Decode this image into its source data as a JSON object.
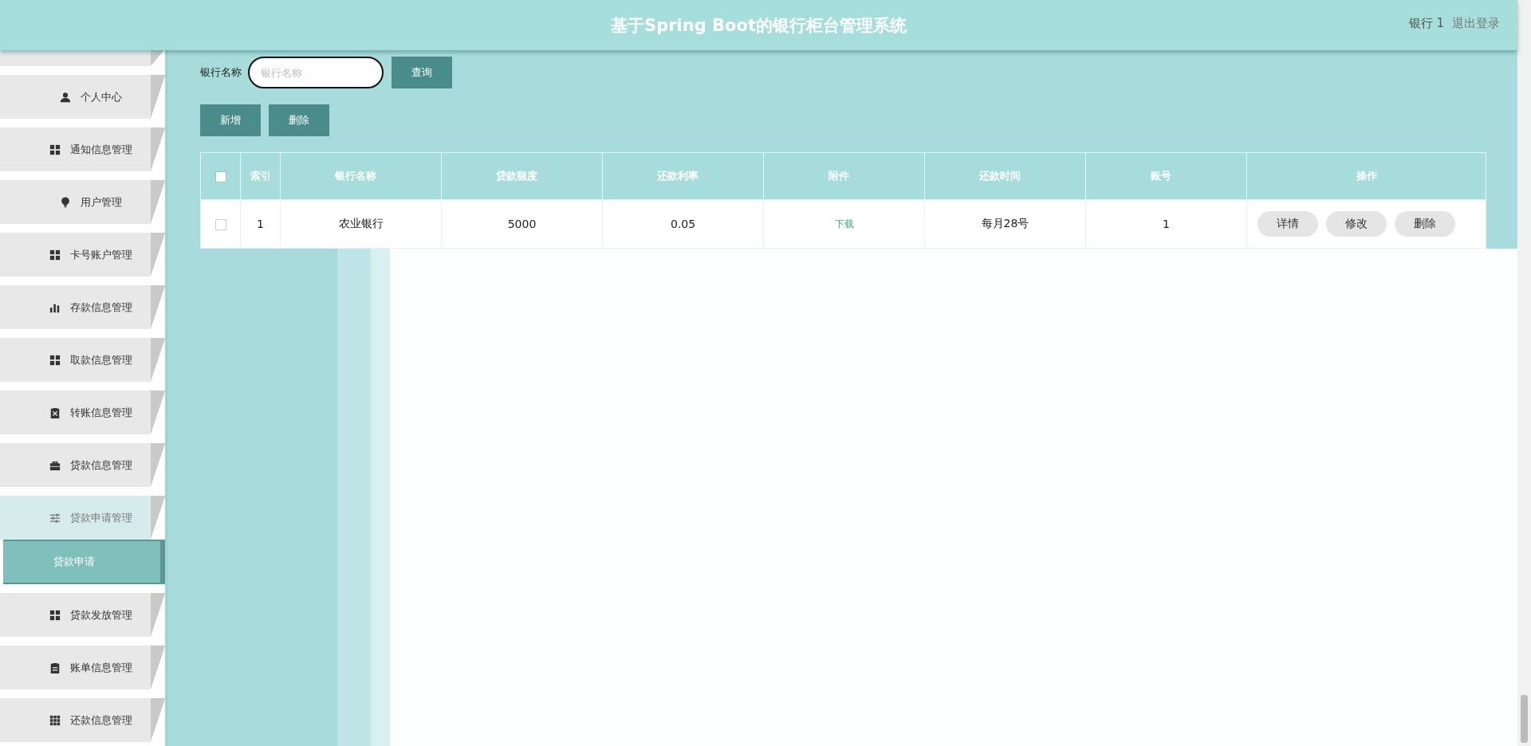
{
  "header": {
    "title": "基于Spring Boot的银行柜台管理系统",
    "user": "银行 1",
    "logout": "退出登录"
  },
  "sidebar": {
    "items": [
      {
        "label": "个人中心",
        "expanded": false
      },
      {
        "label": "通知信息管理",
        "expanded": false
      },
      {
        "label": "用户管理",
        "expanded": false
      },
      {
        "label": "卡号账户管理",
        "expanded": false
      },
      {
        "label": "存款信息管理",
        "expanded": false
      },
      {
        "label": "取款信息管理",
        "expanded": false
      },
      {
        "label": "转账信息管理",
        "expanded": false
      },
      {
        "label": "贷款信息管理",
        "expanded": false
      },
      {
        "label": "贷款申请管理",
        "expanded": true,
        "children": [
          {
            "label": "贷款申请",
            "selected": true
          }
        ]
      },
      {
        "label": "贷款发放管理",
        "expanded": false
      },
      {
        "label": "账单信息管理",
        "expanded": false
      },
      {
        "label": "还款信息管理",
        "expanded": false
      }
    ]
  },
  "search": {
    "label": "银行名称",
    "placeholder": "银行名称",
    "button": "查询"
  },
  "actions": [
    "新增",
    "删除"
  ],
  "table": {
    "select_all_checked": false,
    "columns": [
      {
        "label": "索引",
        "sortable": false
      },
      {
        "label": "银行名称",
        "sortable": true
      },
      {
        "label": "贷款额度",
        "sortable": true
      },
      {
        "label": "还款利率",
        "sortable": true
      },
      {
        "label": "附件",
        "sortable": true
      },
      {
        "label": "还款时间",
        "sortable": true
      },
      {
        "label": "账号",
        "sortable": true
      },
      {
        "label": "操作",
        "sortable": false
      }
    ],
    "rows": [
      {
        "checked": false,
        "index": "1",
        "bank": "农业银行",
        "amount": "5000",
        "rate": "0.05",
        "attachment": "下载",
        "time": "每月28号",
        "account": "1",
        "buttons": [
          "详情",
          "修改",
          "删除"
        ]
      }
    ]
  }
}
